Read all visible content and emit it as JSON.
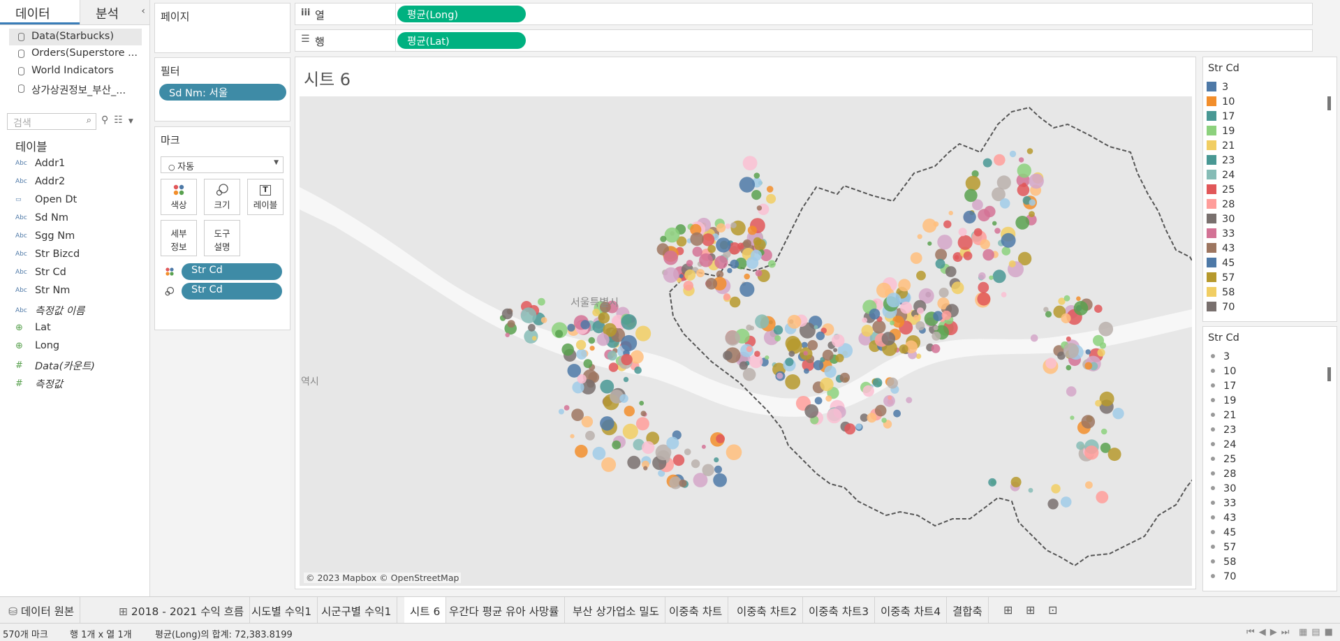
{
  "left_panel": {
    "tab_data": "데이터",
    "tab_analysis": "분석",
    "collapse": "‹",
    "sources": [
      "Data(Starbucks)",
      "Orders(Superstore ...",
      "World Indicators",
      "상가상권정보_부산_..."
    ],
    "search_placeholder": "검색",
    "tables_heading": "테이블",
    "fields": [
      {
        "icon": "Abc",
        "name": "Addr1"
      },
      {
        "icon": "Abc",
        "name": "Addr2"
      },
      {
        "icon": "cal",
        "name": "Open Dt"
      },
      {
        "icon": "Abc",
        "name": "Sd Nm"
      },
      {
        "icon": "Abc",
        "name": "Sgg Nm"
      },
      {
        "icon": "Abc",
        "name": "Str Bizcd"
      },
      {
        "icon": "Abc",
        "name": "Str Cd"
      },
      {
        "icon": "Abc",
        "name": "Str Nm"
      },
      {
        "icon": "Abc",
        "name": "측정값 이름"
      },
      {
        "icon": "globe",
        "name": "Lat"
      },
      {
        "icon": "globe",
        "name": "Long"
      },
      {
        "icon": "#",
        "name": "Data(카운트)"
      },
      {
        "icon": "#",
        "name": "측정값"
      }
    ]
  },
  "shelves": {
    "pages_title": "페이지",
    "filters_title": "필터",
    "filter_pill": "Sd Nm: 서울",
    "marks_title": "마크",
    "mark_type": "자동",
    "mark_buttons": {
      "color": "색상",
      "size": "크기",
      "label": "레이블",
      "detail": "세부\n정보",
      "tooltip": "도구\n설명"
    },
    "mark_pills": [
      "Str Cd",
      "Str Cd"
    ],
    "columns_label": "열",
    "rows_label": "행",
    "columns_pill": "평균(Long)",
    "rows_pill": "평균(Lat)"
  },
  "sheet": {
    "title": "시트 6",
    "map_label_city": "서울특별시",
    "map_label_edge": "역시",
    "attribution": "© 2023 Mapbox © OpenStreetMap"
  },
  "legend_color": {
    "title": "Str Cd",
    "items": [
      {
        "label": "3",
        "color": "#4e79a7"
      },
      {
        "label": "10",
        "color": "#f28e2b"
      },
      {
        "label": "17",
        "color": "#499894"
      },
      {
        "label": "19",
        "color": "#8cd17d"
      },
      {
        "label": "21",
        "color": "#f1ce63"
      },
      {
        "label": "23",
        "color": "#499894"
      },
      {
        "label": "24",
        "color": "#86bcb6"
      },
      {
        "label": "25",
        "color": "#e15759"
      },
      {
        "label": "28",
        "color": "#ff9d9a"
      },
      {
        "label": "30",
        "color": "#79706e"
      },
      {
        "label": "33",
        "color": "#d37295"
      },
      {
        "label": "43",
        "color": "#9d7660"
      },
      {
        "label": "45",
        "color": "#4e79a7"
      },
      {
        "label": "57",
        "color": "#b6992d"
      },
      {
        "label": "58",
        "color": "#f1ce63"
      },
      {
        "label": "70",
        "color": "#79706e"
      }
    ]
  },
  "legend_size": {
    "title": "Str Cd",
    "items": [
      "3",
      "10",
      "17",
      "19",
      "21",
      "23",
      "24",
      "25",
      "28",
      "30",
      "33",
      "43",
      "45",
      "57",
      "58",
      "70"
    ]
  },
  "sheet_tabs": [
    "데이터 원본",
    "2018 - 2021 수익 흐름",
    "시도별 수익1",
    "시군구별 수익1",
    "시트 6",
    "우간다 평균 유아 사망률",
    "부산 상가업소 밀도",
    "이중축 차트",
    "이중축 차트2",
    "이중축 차트3",
    "이중축 차트4",
    "결합축"
  ],
  "active_tab": "시트 6",
  "status": {
    "marks": "570개 마크",
    "rows_cols": "행 1개 x 열 1개",
    "sum": "평균(Long)의 합계: 72,383.8199"
  },
  "palette": [
    "#4e79a7",
    "#f28e2b",
    "#59a14f",
    "#8cd17d",
    "#f1ce63",
    "#499894",
    "#86bcb6",
    "#e15759",
    "#ff9d9a",
    "#79706e",
    "#d37295",
    "#9d7660",
    "#b6992d",
    "#a0cbe8",
    "#fabfd2",
    "#ffbe7d",
    "#bab0ac",
    "#d4a6c8"
  ]
}
